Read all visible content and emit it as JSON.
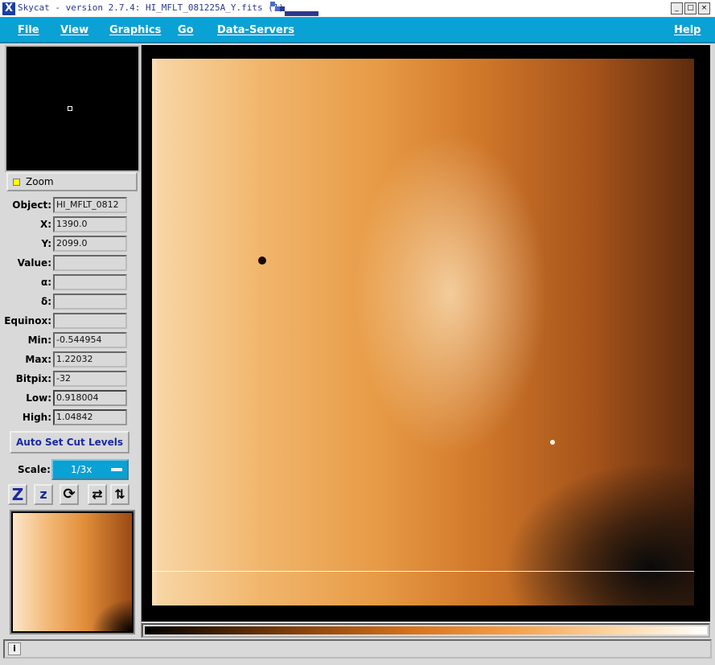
{
  "window": {
    "title": "Skycat - version 2.7.4: HI_MFLT_081225A_Y.fits (1)",
    "app_icon": "X",
    "minimize_label": "_",
    "maximize_label": "□",
    "close_label": "×"
  },
  "menubar": {
    "items": [
      "File",
      "View",
      "Graphics",
      "Go",
      "Data-Servers"
    ],
    "help": "Help"
  },
  "panel": {
    "zoom_label": "Zoom",
    "info": [
      {
        "label": "Object:",
        "value": "HI_MFLT_0812"
      },
      {
        "label": "X:",
        "value": "1390.0"
      },
      {
        "label": "Y:",
        "value": "2099.0"
      },
      {
        "label": "Value:",
        "value": ""
      },
      {
        "label": "α:",
        "value": ""
      },
      {
        "label": "δ:",
        "value": ""
      },
      {
        "label": "Equinox:",
        "value": ""
      },
      {
        "label": "Min:",
        "value": "-0.544954"
      },
      {
        "label": "Max:",
        "value": "1.22032"
      },
      {
        "label": "Bitpix:",
        "value": "-32"
      },
      {
        "label": "Low:",
        "value": "0.918004"
      },
      {
        "label": "High:",
        "value": "1.04842"
      }
    ],
    "auto_cut_button": "Auto Set Cut Levels",
    "scale_label": "Scale:",
    "scale_value": "1/3x",
    "tools": [
      {
        "icon": "zoom-in-icon",
        "glyph": "Z"
      },
      {
        "icon": "zoom-out-icon",
        "glyph": "z"
      },
      {
        "icon": "rotate-icon",
        "glyph": "⟳"
      },
      {
        "icon": "flip-x-icon",
        "glyph": "⇄"
      },
      {
        "icon": "flip-y-icon",
        "glyph": "⇅"
      }
    ]
  },
  "status": {
    "icon": "info-icon",
    "icon_glyph": "i",
    "text": ""
  },
  "colors": {
    "menubar": "#0aa1d4",
    "button_text": "#1a2aa0",
    "background": "#d9d9d9"
  }
}
